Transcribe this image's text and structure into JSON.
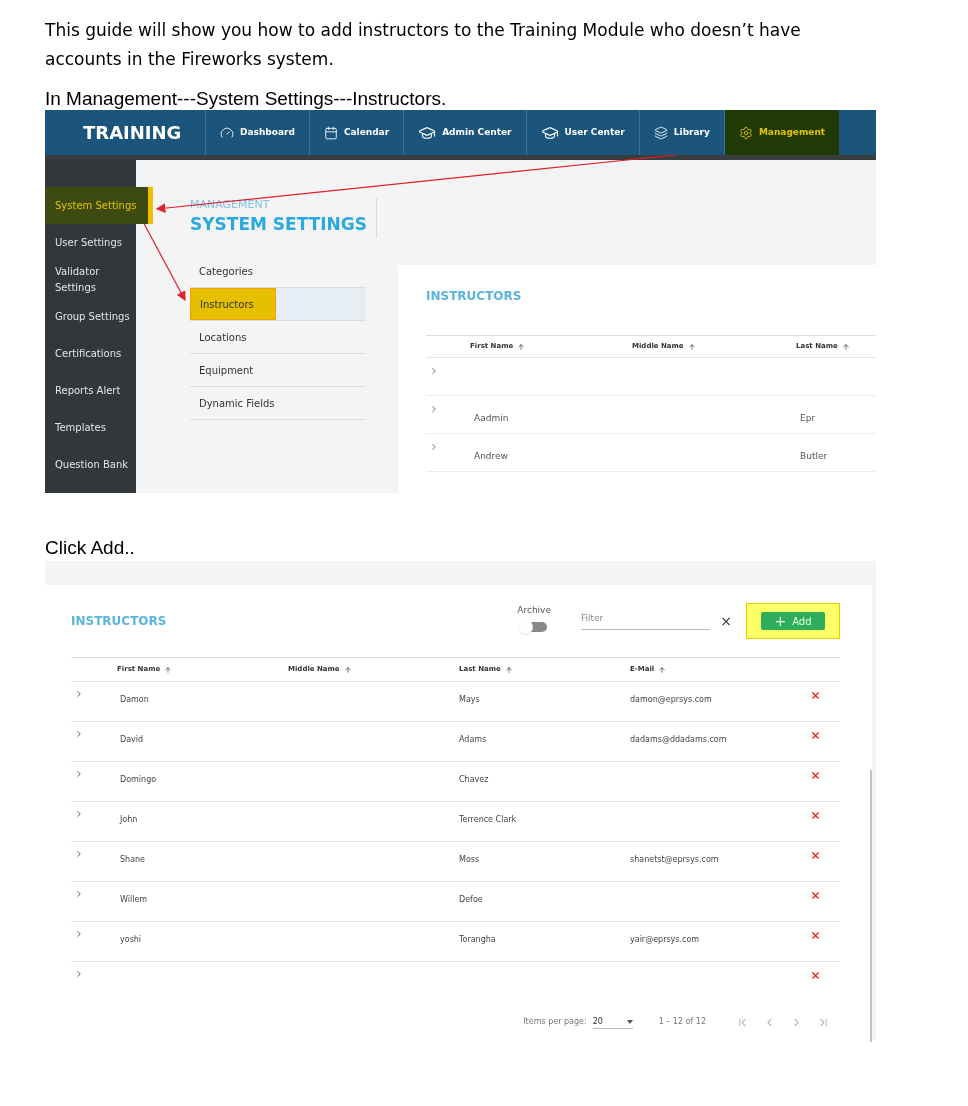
{
  "intro": "This guide will show you how to add instructors to the Training Module who doesn’t have accounts in the Fireworks system.",
  "step_1": {
    "caption": "In Management---System Settings---Instructors.",
    "screenshot": {
      "brand": "TRAINING",
      "nav": [
        {
          "kind": "dashboard",
          "label": "Dashboard",
          "selected": false
        },
        {
          "kind": "calendar",
          "label": "Calendar",
          "selected": false
        },
        {
          "kind": "admin",
          "label": "Admin Center",
          "selected": false
        },
        {
          "kind": "user",
          "label": "User Center",
          "selected": false
        },
        {
          "kind": "library",
          "label": "Library",
          "selected": false
        },
        {
          "kind": "management",
          "label": "Management",
          "selected": true
        }
      ],
      "sidebar": [
        {
          "label": "System Settings",
          "selected": true
        },
        {
          "label": "User Settings",
          "selected": false
        },
        {
          "label": "Validator Settings",
          "selected": false
        },
        {
          "label": "Group Settings",
          "selected": false
        },
        {
          "label": "Certifications",
          "selected": false
        },
        {
          "label": "Reports Alert",
          "selected": false
        },
        {
          "label": "Templates",
          "selected": false
        },
        {
          "label": "Question Bank",
          "selected": false
        }
      ],
      "overline": "MANAGEMENT",
      "title": "SYSTEM SETTINGS",
      "submenu": [
        {
          "label": "Categories",
          "selected": false
        },
        {
          "label": "Instructors",
          "selected": true
        },
        {
          "label": "Locations",
          "selected": false
        },
        {
          "label": "Equipment",
          "selected": false
        },
        {
          "label": "Dynamic Fields",
          "selected": false
        }
      ],
      "panel_title": "INSTRUCTORS",
      "columns": [
        "First Name",
        "Middle Name",
        "Last Name"
      ],
      "rows": [
        {
          "first": "",
          "middle": "",
          "last": ""
        },
        {
          "first": "Aadmin",
          "middle": "",
          "last": "Epr"
        },
        {
          "first": "Andrew",
          "middle": "",
          "last": "Butler"
        }
      ]
    }
  },
  "step_2": {
    "caption": "Click Add..",
    "screenshot": {
      "panel_title": "INSTRUCTORS",
      "archive_label": "Archive",
      "archive_on": false,
      "filter_placeholder": "Filter",
      "clear": "×",
      "add_button": {
        "icon": "+",
        "label": "Add",
        "highlighted": true
      },
      "columns": [
        "First Name",
        "Middle Name",
        "Last Name",
        "E-Mail"
      ],
      "rows": [
        {
          "first": "Damon",
          "middle": "",
          "last": "Mays",
          "email": "damon@eprsys.com"
        },
        {
          "first": "David",
          "middle": "",
          "last": "Adams",
          "email": "dadams@ddadams.com"
        },
        {
          "first": "Domingo",
          "middle": "",
          "last": "Chavez",
          "email": ""
        },
        {
          "first": "John",
          "middle": "",
          "last": "Terrence Clark",
          "email": ""
        },
        {
          "first": "Shane",
          "middle": "",
          "last": "Moss",
          "email": "shanetst@eprsys.com"
        },
        {
          "first": "Willem",
          "middle": "",
          "last": "Defoe",
          "email": ""
        },
        {
          "first": "yoshi",
          "middle": "",
          "last": "Torangha",
          "email": "yair@eprsys.com"
        },
        {
          "first": "",
          "middle": "",
          "last": "",
          "email": ""
        }
      ],
      "items_per_page_label": "Items per page:",
      "items_per_page": "20",
      "range": "1 – 12 of 12"
    }
  }
}
